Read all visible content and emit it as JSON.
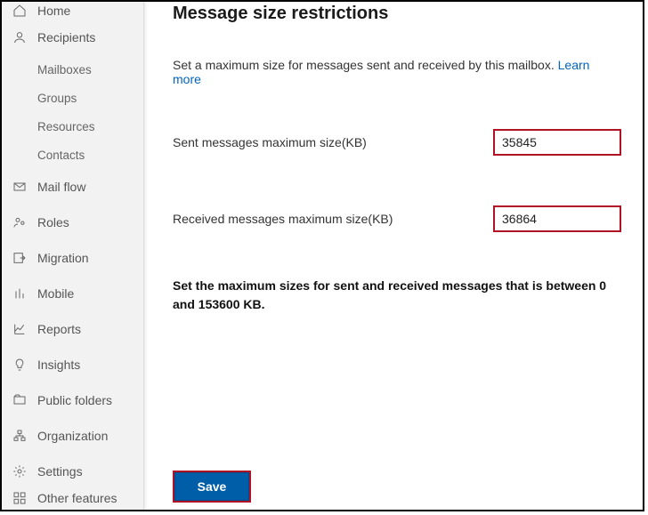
{
  "sidebar": {
    "items": [
      {
        "label": "Home",
        "icon": "home-icon"
      },
      {
        "label": "Recipients",
        "icon": "user-icon"
      },
      {
        "label": "Mail flow",
        "icon": "mail-icon"
      },
      {
        "label": "Roles",
        "icon": "roles-icon"
      },
      {
        "label": "Migration",
        "icon": "migration-icon"
      },
      {
        "label": "Mobile",
        "icon": "mobile-icon"
      },
      {
        "label": "Reports",
        "icon": "reports-icon"
      },
      {
        "label": "Insights",
        "icon": "insights-icon"
      },
      {
        "label": "Public folders",
        "icon": "folders-icon"
      },
      {
        "label": "Organization",
        "icon": "org-icon"
      },
      {
        "label": "Settings",
        "icon": "settings-icon"
      },
      {
        "label": "Other features",
        "icon": "other-icon"
      }
    ],
    "subitems": [
      "Mailboxes",
      "Groups",
      "Resources",
      "Contacts"
    ]
  },
  "main": {
    "title": "Message size restrictions",
    "description": "Set a maximum size for messages sent and received by this mailbox. ",
    "learn_more": "Learn more",
    "sent_label": "Sent messages maximum size(KB)",
    "sent_value": "35845",
    "received_label": "Received messages maximum size(KB)",
    "received_value": "36864",
    "note": "Set the maximum sizes for sent and received messages that is between 0 and 153600 KB.",
    "save_label": "Save"
  }
}
